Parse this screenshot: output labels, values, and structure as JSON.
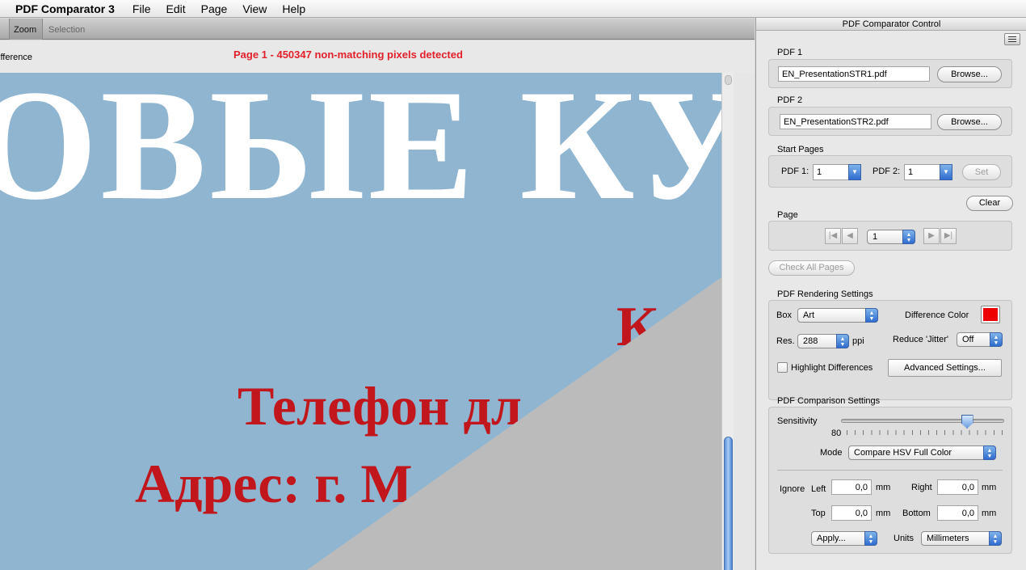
{
  "menubar": {
    "app_name": "PDF Comparator 3",
    "items": [
      "File",
      "Edit",
      "Page",
      "View",
      "Help"
    ]
  },
  "toolbar": {
    "zoom_label": "Zoom",
    "selection_label": "Selection"
  },
  "document": {
    "view_label": "ifference",
    "status": "Page 1 -  450347 non-matching pixels detected",
    "page_text": {
      "heading": "ОВЫЕ КУ",
      "red_letter": "К",
      "line1": "Телефон дл",
      "line2": "Адрес: г. М"
    }
  },
  "panel": {
    "title": "PDF Comparator Control",
    "pdf1": {
      "label": "PDF 1",
      "file": "EN_PresentationSTR1.pdf",
      "browse": "Browse..."
    },
    "pdf2": {
      "label": "PDF 2",
      "file": "EN_PresentationSTR2.pdf",
      "browse": "Browse..."
    },
    "start_pages": {
      "label": "Start Pages",
      "pdf1_label": "PDF 1:",
      "pdf1_value": "1",
      "pdf2_label": "PDF 2:",
      "pdf2_value": "1",
      "set": "Set"
    },
    "clear": "Clear",
    "page": {
      "label": "Page",
      "value": "1"
    },
    "check_all": "Check All Pages",
    "rendering": {
      "label": "PDF Rendering Settings",
      "box_label": "Box",
      "box_value": "Art",
      "diff_color_label": "Difference Color",
      "diff_color": "#ee0000",
      "res_label": "Res.",
      "res_value": "288",
      "res_unit": "ppi",
      "jitter_label": "Reduce 'Jitter'",
      "jitter_value": "Off",
      "highlight_label": "Highlight Differences",
      "highlight_checked": false,
      "advanced": "Advanced Settings..."
    },
    "comparison": {
      "label": "PDF Comparison Settings",
      "sensitivity_label": "Sensitivity",
      "sensitivity_value": "80",
      "sensitivity_fraction": 0.77,
      "mode_label": "Mode",
      "mode_value": "Compare HSV Full Color",
      "ignore_label": "Ignore",
      "left_label": "Left",
      "left_value": "0,0",
      "right_label": "Right",
      "right_value": "0,0",
      "top_label": "Top",
      "top_value": "0,0",
      "bottom_label": "Bottom",
      "bottom_value": "0,0",
      "unit_short": "mm",
      "apply": "Apply...",
      "units_label": "Units",
      "units_value": "Millimeters"
    }
  }
}
